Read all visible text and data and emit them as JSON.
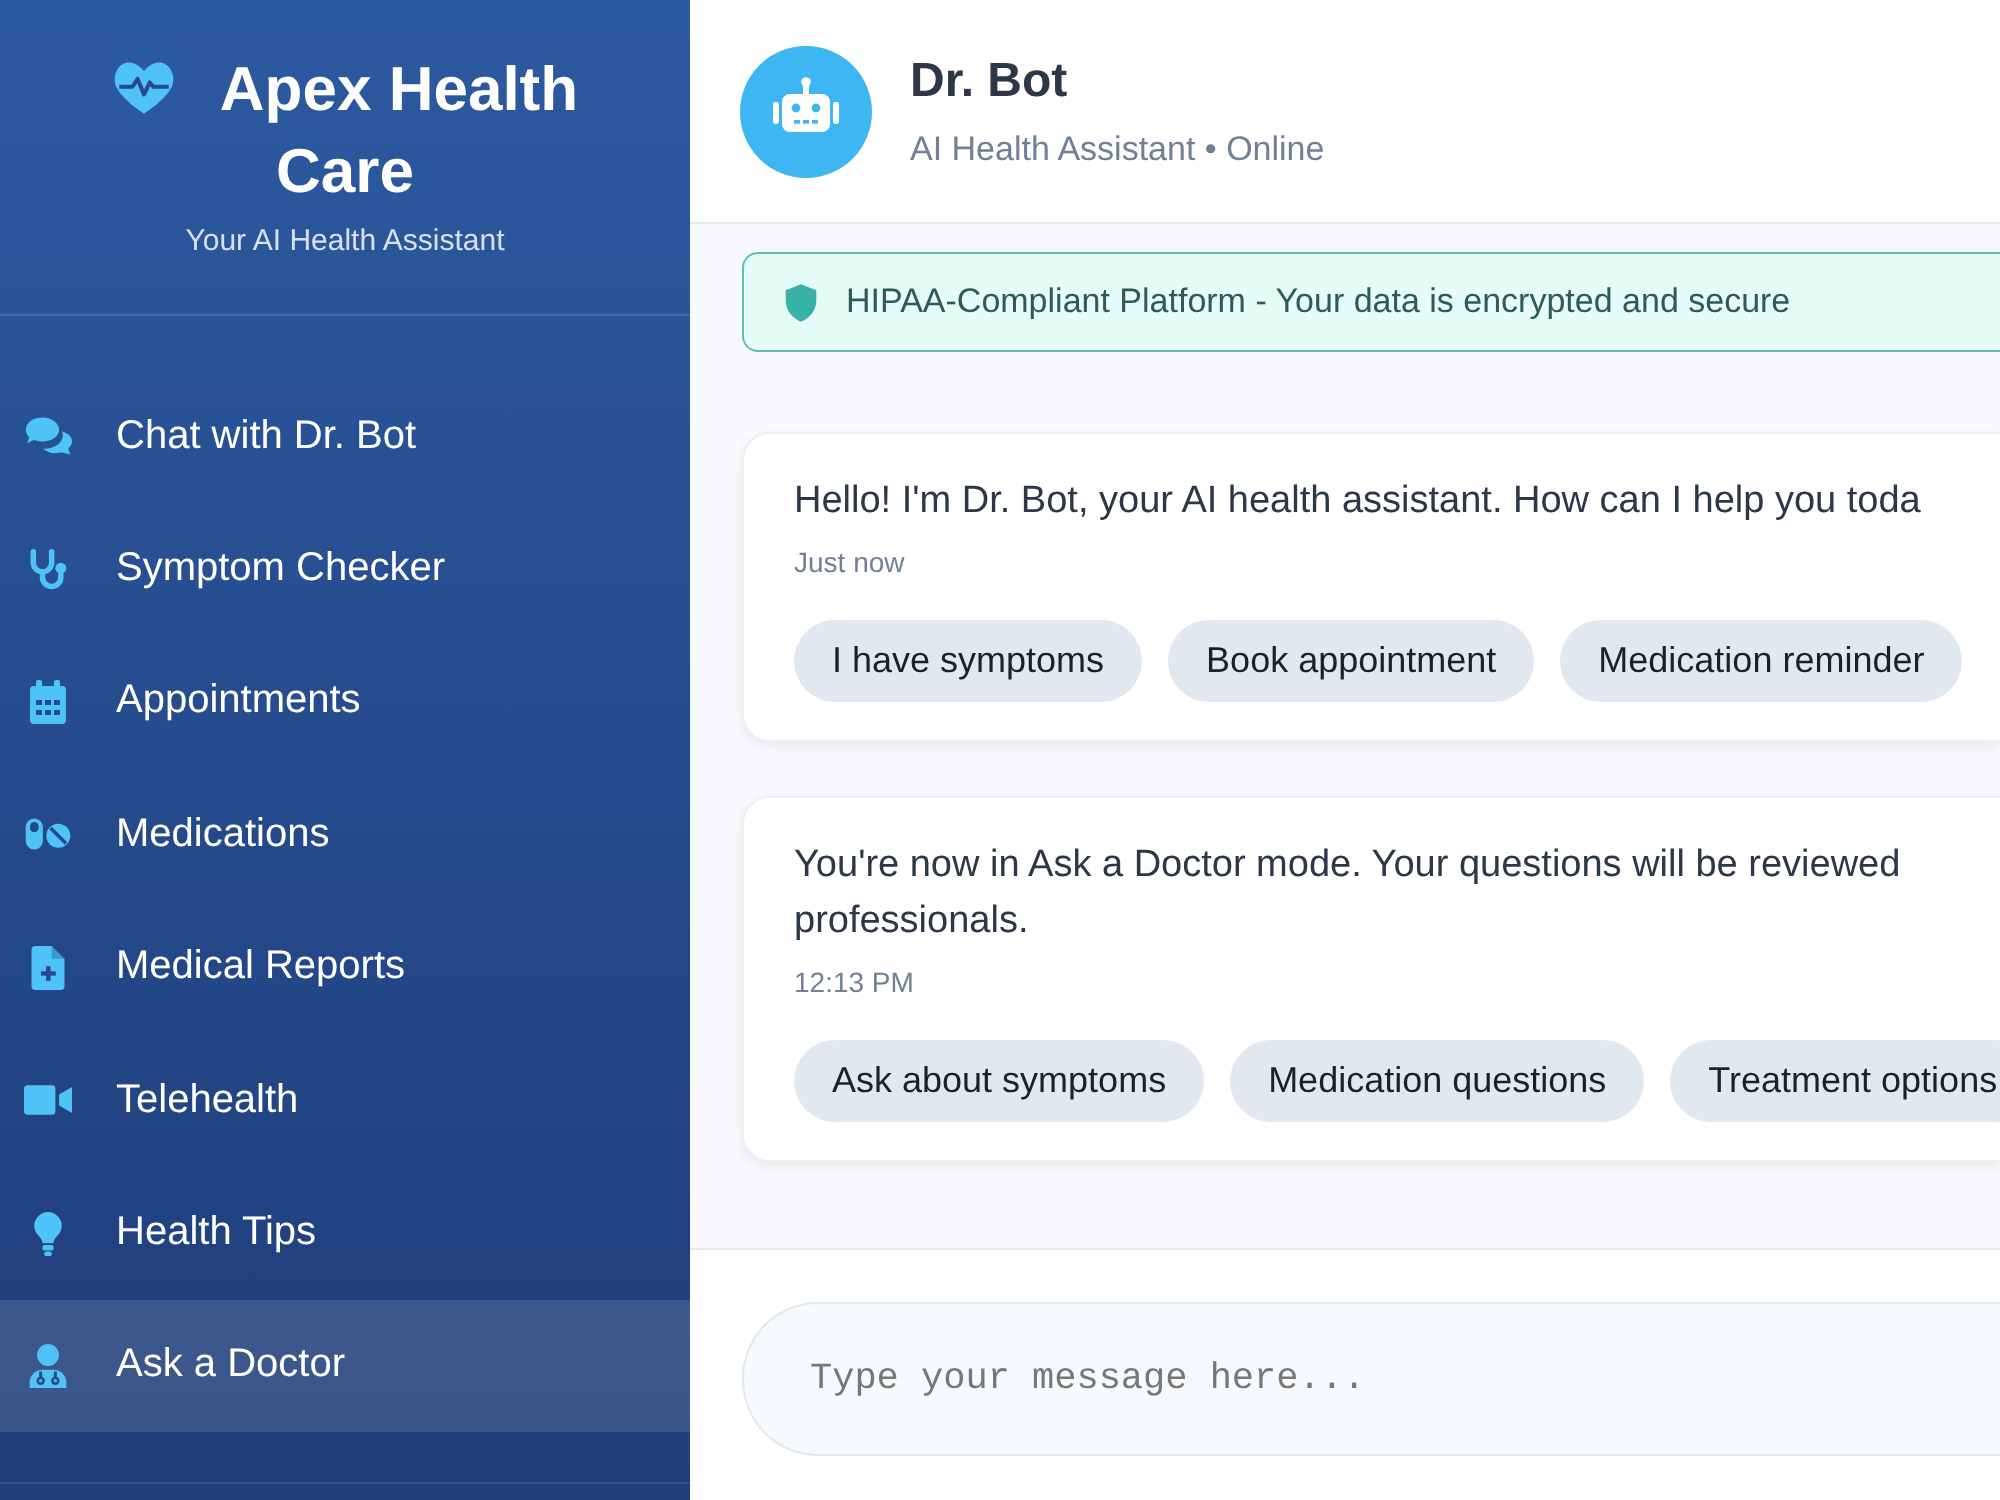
{
  "sidebar": {
    "title": "Apex Health Care",
    "tagline": "Your AI Health Assistant",
    "nav_items": [
      {
        "label": "Chat with Dr. Bot",
        "selected": false
      },
      {
        "label": "Symptom Checker",
        "selected": false
      },
      {
        "label": "Appointments",
        "selected": false
      },
      {
        "label": "Medications",
        "selected": false
      },
      {
        "label": "Medical Reports",
        "selected": false
      },
      {
        "label": "Telehealth",
        "selected": false
      },
      {
        "label": "Health Tips",
        "selected": false
      },
      {
        "label": "Ask a Doctor",
        "selected": true
      }
    ]
  },
  "chat_header": {
    "name": "Dr. Bot",
    "status": "AI Health Assistant • Online"
  },
  "notice": "HIPAA-Compliant Platform - Your data is encrypted and secure",
  "messages": [
    {
      "lines": [
        "Hello! I'm Dr. Bot, your AI health assistant. How can I help you toda"
      ],
      "time": "Just now",
      "quick_replies": [
        "I have symptoms",
        "Book appointment",
        "Medication reminder"
      ]
    },
    {
      "lines": [
        "You're now in Ask a Doctor mode. Your questions will be reviewed",
        "professionals."
      ],
      "time": "12:13 PM",
      "quick_replies": [
        "Ask about symptoms",
        "Medication questions",
        "Treatment options"
      ]
    }
  ],
  "composer": {
    "placeholder": "Type your message here..."
  }
}
